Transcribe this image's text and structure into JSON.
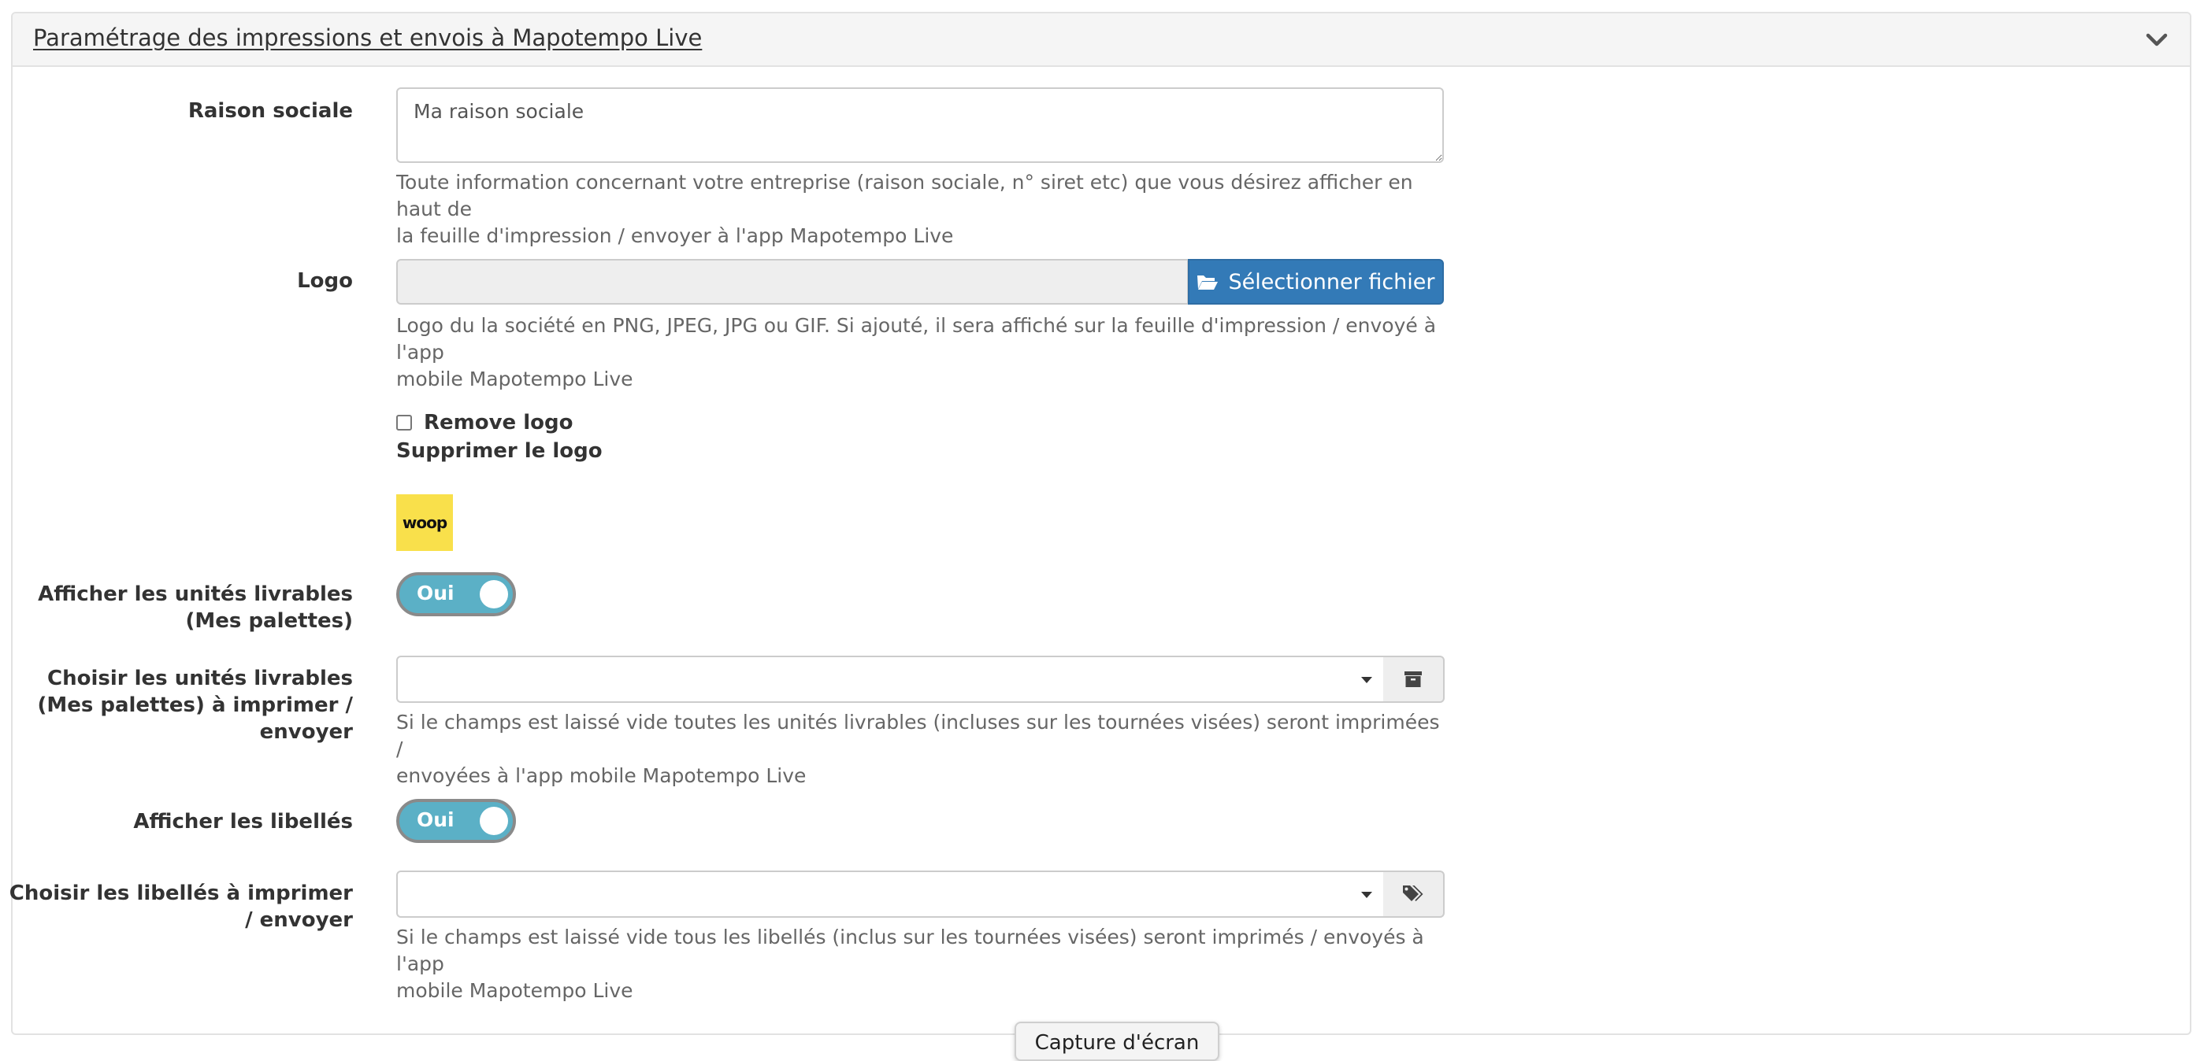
{
  "panel": {
    "title": "Paramétrage des impressions et envois à Mapotempo Live",
    "collapse_icon": "chevron-down-icon"
  },
  "raison_sociale": {
    "label": "Raison sociale",
    "value": "Ma raison sociale",
    "help_line1": "Toute information concernant votre entreprise (raison sociale, n° siret etc) que vous désirez afficher en haut de",
    "help_line2": "la feuille d'impression / envoyer à l'app Mapotempo Live"
  },
  "logo": {
    "label": "Logo",
    "button_label": "Sélectionner fichier",
    "button_icon": "folder-open-icon",
    "help_line1": "Logo du la société en PNG, JPEG, JPG ou GIF. Si ajouté, il sera affiché sur la feuille d'impression / envoyé à l'app",
    "help_line2": "mobile Mapotempo Live",
    "remove_label": "Remove logo",
    "remove_sub": "Supprimer le logo",
    "thumbnail_text": "woop",
    "thumbnail_color": "#f9e04b"
  },
  "deliverable_units_toggle": {
    "label_line1": "Afficher les unités livrables",
    "label_line2": "(Mes palettes)",
    "state": "Oui"
  },
  "deliverable_units_select": {
    "label_line1": "Choisir les unités livrables",
    "label_line2": "(Mes palettes) à imprimer /",
    "label_line3": "envoyer",
    "addon_icon": "archive-icon",
    "help_line1": "Si le champs est laissé vide toutes les unités livrables (incluses sur les tournées visées) seront imprimées /",
    "help_line2": "envoyées à l'app mobile Mapotempo Live"
  },
  "tags_toggle": {
    "label": "Afficher les libellés",
    "state": "Oui"
  },
  "tags_select": {
    "label_line1": "Choisir les libellés à imprimer",
    "label_line2": "/ envoyer",
    "addon_icon": "tags-icon",
    "help_line1": "Si le champs est laissé vide tous les libellés (inclus sur les tournées visées) seront imprimés / envoyés à l'app",
    "help_line2": "mobile Mapotempo Live"
  },
  "screenshot_button": "Capture d'écran",
  "colors": {
    "primary_button": "#337ab7",
    "toggle_on": "#5bb0c6"
  }
}
